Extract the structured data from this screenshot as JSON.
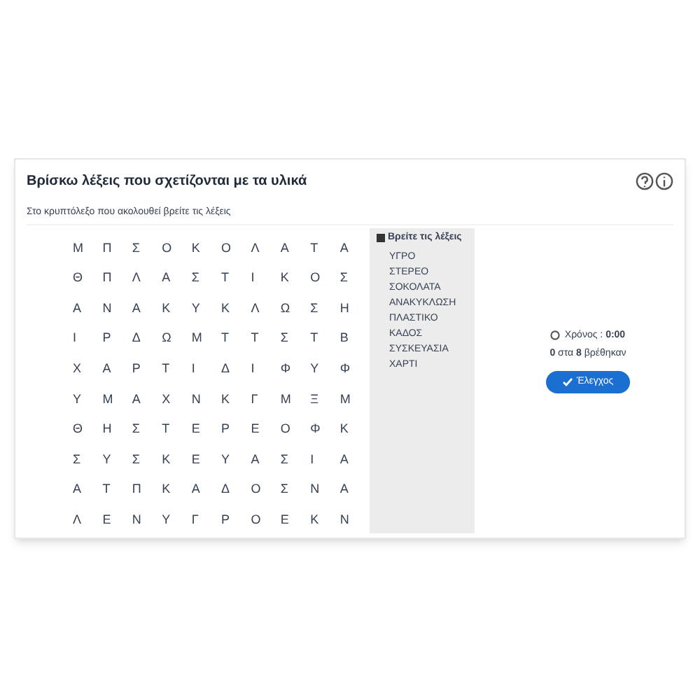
{
  "title": "Βρίσκω λέξεις που σχετίζονται με τα υλικά",
  "instruction": "Στο κρυπτόλεξο που ακολουθεί βρείτε τις λέξεις",
  "grid": [
    [
      "Μ",
      "Π",
      "Σ",
      "Ο",
      "Κ",
      "Ο",
      "Λ",
      "Α",
      "Τ",
      "Α"
    ],
    [
      "Θ",
      "Π",
      "Λ",
      "Α",
      "Σ",
      "Τ",
      "Ι",
      "Κ",
      "Ο",
      "Σ"
    ],
    [
      "Α",
      "Ν",
      "Α",
      "Κ",
      "Υ",
      "Κ",
      "Λ",
      "Ω",
      "Σ",
      "Η"
    ],
    [
      "Ι",
      "Ρ",
      "Δ",
      "Ω",
      "Μ",
      "Τ",
      "Τ",
      "Σ",
      "Τ",
      "Β"
    ],
    [
      "Χ",
      "Α",
      "Ρ",
      "Τ",
      "Ι",
      "Δ",
      "Ι",
      "Φ",
      "Υ",
      "Φ"
    ],
    [
      "Υ",
      "Μ",
      "Α",
      "Χ",
      "Ν",
      "Κ",
      "Γ",
      "Μ",
      "Ξ",
      "Μ"
    ],
    [
      "Θ",
      "Η",
      "Σ",
      "Τ",
      "Ε",
      "Ρ",
      "Ε",
      "Ο",
      "Φ",
      "Κ"
    ],
    [
      "Σ",
      "Υ",
      "Σ",
      "Κ",
      "Ε",
      "Υ",
      "Α",
      "Σ",
      "Ι",
      "Α"
    ],
    [
      "Α",
      "Τ",
      "Π",
      "Κ",
      "Α",
      "Δ",
      "Ο",
      "Σ",
      "Ν",
      "Α"
    ],
    [
      "Λ",
      "Ε",
      "Ν",
      "Υ",
      "Γ",
      "Ρ",
      "Ο",
      "Ε",
      "Κ",
      "Ν"
    ]
  ],
  "word_list": {
    "heading": "Βρείτε τις λέξεις",
    "words": [
      "ΥΓΡΟ",
      "ΣΤΕΡΕΟ",
      "ΣΟΚΟΛΑΤΑ",
      "ΑΝΑΚΥΚΛΩΣΗ",
      "ΠΛΑΣΤΙΚΟ",
      "ΚΑΔΟΣ",
      "ΣΥΣΚΕΥΑΣΙΑ",
      "ΧΑΡΤΙ"
    ]
  },
  "timer": "Χρόνος : **0:00**",
  "found": "**0** στα **8** βρέθηκαν",
  "check_button": "Έλεγχος"
}
